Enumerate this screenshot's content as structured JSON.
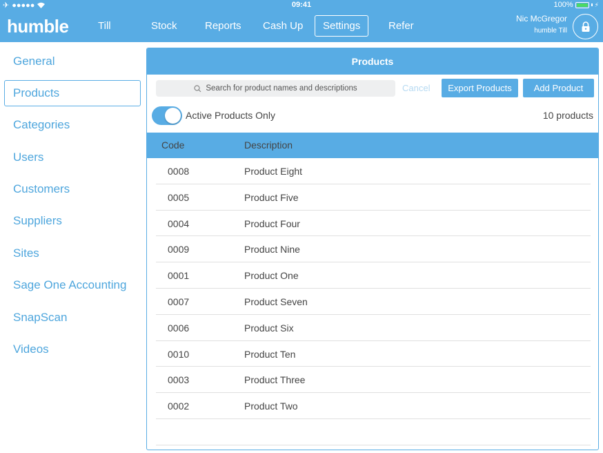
{
  "status_bar": {
    "time": "09:41",
    "battery": "100%"
  },
  "header": {
    "brand": "humble",
    "nav": [
      "Till",
      "Stock",
      "Reports",
      "Cash Up",
      "Settings",
      "Refer"
    ],
    "active_nav": "Settings",
    "user": {
      "name": "Nic McGregor",
      "till": "humble Till"
    },
    "lock_icon": "lock-icon"
  },
  "sidebar": {
    "items": [
      "General",
      "Products",
      "Categories",
      "Users",
      "Customers",
      "Suppliers",
      "Sites",
      "Sage One Accounting",
      "SnapScan",
      "Videos"
    ],
    "active": "Products"
  },
  "panel": {
    "title": "Products",
    "search_placeholder": "Search for product names and descriptions",
    "cancel_label": "Cancel",
    "export_label": "Export Products",
    "add_label": "Add Product",
    "toggle_label": "Active Products Only",
    "toggle_on": true,
    "count_label": "10 products",
    "columns": {
      "code": "Code",
      "description": "Description"
    },
    "rows": [
      {
        "code": "0008",
        "description": "Product Eight"
      },
      {
        "code": "0005",
        "description": "Product Five"
      },
      {
        "code": "0004",
        "description": "Product Four"
      },
      {
        "code": "0009",
        "description": "Product Nine"
      },
      {
        "code": "0001",
        "description": "Product One"
      },
      {
        "code": "0007",
        "description": "Product Seven"
      },
      {
        "code": "0006",
        "description": "Product Six"
      },
      {
        "code": "0010",
        "description": "Product Ten"
      },
      {
        "code": "0003",
        "description": "Product Three"
      },
      {
        "code": "0002",
        "description": "Product Two"
      }
    ]
  },
  "colors": {
    "accent": "#58ace4",
    "link": "#4ea6dd",
    "battery": "#4cd964"
  }
}
